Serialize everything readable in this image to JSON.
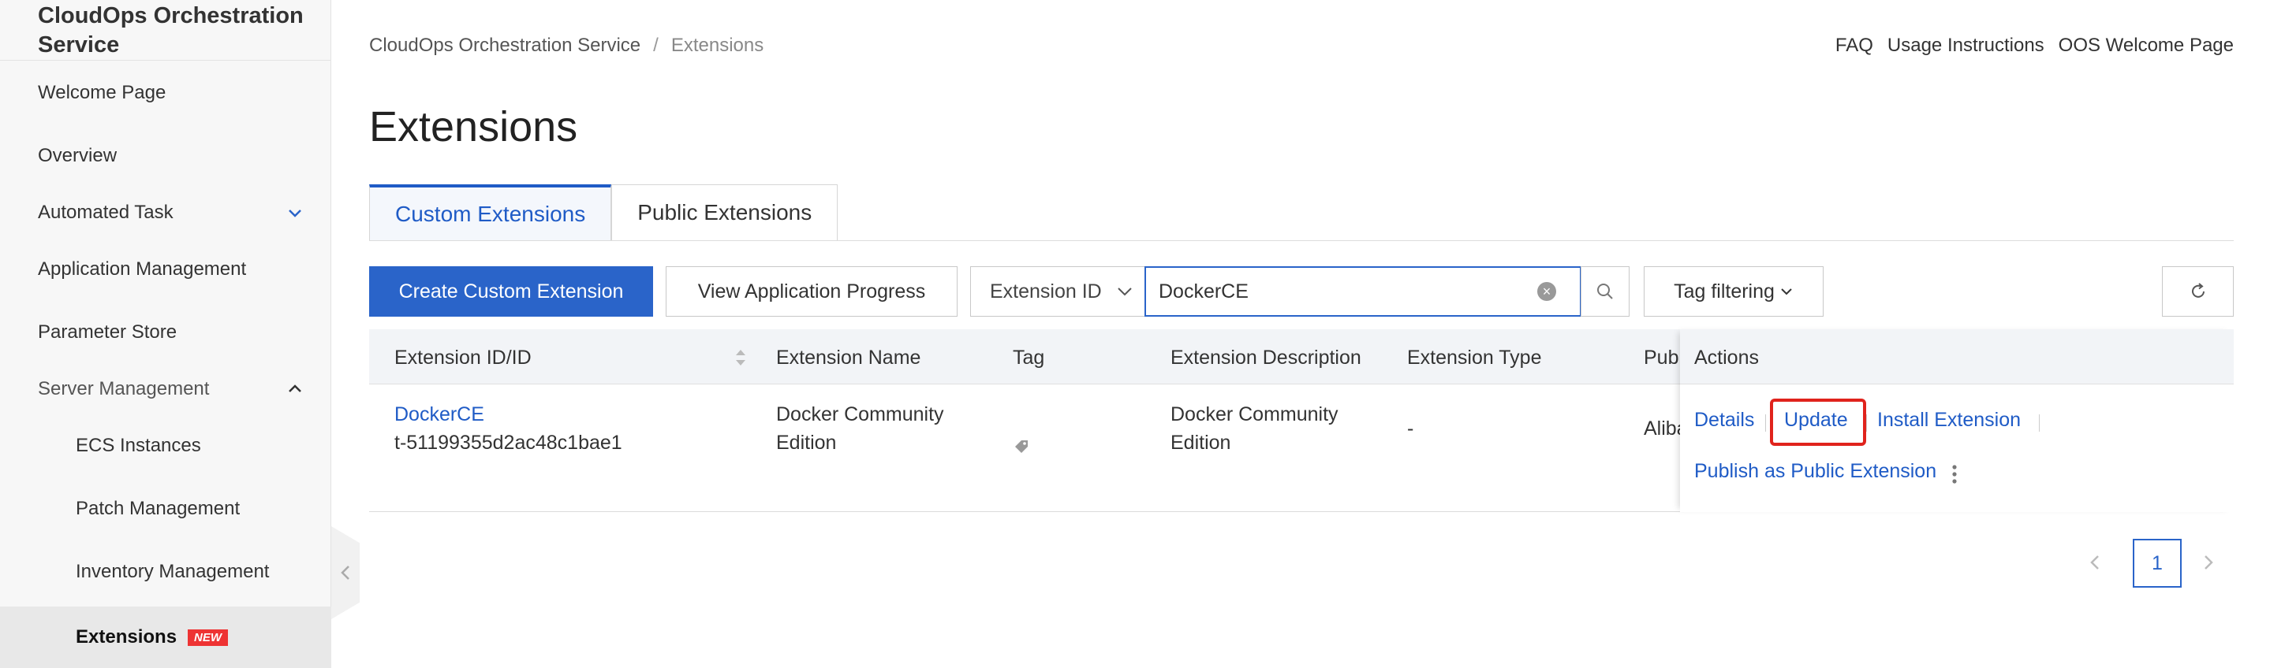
{
  "sidebar": {
    "title": "CloudOps Orchestration Service",
    "items": [
      {
        "label": "Welcome Page"
      },
      {
        "label": "Overview"
      },
      {
        "label": "Automated Task"
      },
      {
        "label": "Application Management"
      },
      {
        "label": "Parameter Store"
      },
      {
        "label": "Server Management"
      },
      {
        "label": "ECS Instances"
      },
      {
        "label": "Patch Management"
      },
      {
        "label": "Inventory Management"
      },
      {
        "label": "Extensions",
        "badge": "NEW"
      }
    ]
  },
  "header": {
    "breadcrumb": [
      "CloudOps Orchestration Service",
      "/",
      "Extensions"
    ],
    "links": [
      "FAQ",
      "Usage Instructions",
      "OOS Welcome Page"
    ],
    "title": "Extensions"
  },
  "tabs": [
    {
      "label": "Custom Extensions",
      "active": true
    },
    {
      "label": "Public Extensions",
      "active": false
    }
  ],
  "toolbar": {
    "create_label": "Create Custom Extension",
    "progress_label": "View Application Progress",
    "filter_field": "Extension ID",
    "search_value": "DockerCE",
    "tag_filter_label": "Tag filtering"
  },
  "table": {
    "columns": [
      "Extension ID/ID",
      "Extension Name",
      "Tag",
      "Extension Description",
      "Extension Type",
      "Publ",
      "Actions"
    ],
    "rows": [
      {
        "name_link": "DockerCE",
        "id": "t-51199355d2ac48c1bae1",
        "ext_name": [
          "Docker Community",
          "Edition"
        ],
        "description": [
          "Docker Community",
          "Edition"
        ],
        "type": "-",
        "publisher": "Aliba",
        "actions": [
          "Details",
          "Update",
          "Install Extension",
          "Publish as Public Extension"
        ]
      }
    ]
  },
  "pagination": {
    "current": "1"
  },
  "colors": {
    "primary": "#2a64c9",
    "highlight": "#e0231c",
    "badge": "#e33"
  }
}
